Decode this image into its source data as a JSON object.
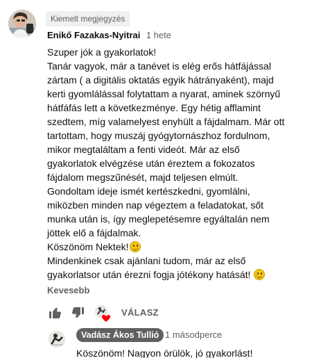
{
  "comment": {
    "pinned_label": "Kiemelt megjegyzés",
    "author": "Enikő Fazakas-Nyitrai",
    "time": "1 hete",
    "lines": [
      "Szuper jók a gyakorlatok!",
      "Tanár vagyok, már a tanévet is elég erős hátfájással",
      "zártam ( a digitális oktatás egyik hátrányaként), majd",
      "kerti gyomlálással folytattam a nyarat, aminek szörnyű",
      "hátfáfás lett a következménye. Egy hétig afflamint",
      "szedtem, míg valamelyest enyhült a fájdalmam. Már ott",
      "tartottam, hogy muszáj gyógytornászhoz  fordulnom,",
      "mikor megtaláltam a fenti videót. Már az első",
      "gyakorlatok elvégzése után éreztem a fokozatos",
      "fájdalom megszűnését, majd teljesen elmúlt.",
      "Gondoltam ideje ismét kertészkedni, gyomlálni,",
      "miközben minden nap végeztem a feladatokat, sőt",
      "munka után is, így meglepetésemre egyáltalán nem",
      "jöttek elő a fájdalmak.",
      "Köszönöm Nektek!",
      "Mindenkinek csak ajánlani tudom, már az első",
      "gyakorlatsor után érezni fogja jótékony hatását! "
    ],
    "emoji_icon": "smiling-face-emoji",
    "show_less_label": "Kevesebb",
    "reply_label": "VÁLASZ",
    "icons": {
      "like": "thumbs-up-icon",
      "dislike": "thumbs-down-icon",
      "creator_heart": "creator-heart-icon"
    }
  },
  "reply": {
    "author": "Vadász Ákos Tullió",
    "time": "1 másodperce",
    "text": "Köszönöm! Nagyon örülök, jó gyakorlást!"
  },
  "colors": {
    "text": "#0f0f0f",
    "secondary_text": "#606060",
    "badge_bg": "#f0f0f0",
    "heart": "#ff0000"
  }
}
